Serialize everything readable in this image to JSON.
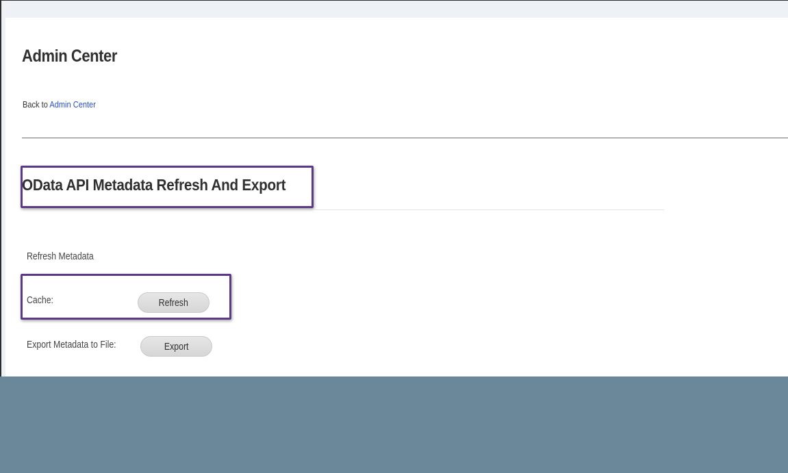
{
  "header": {
    "title": "Admin Center",
    "breadcrumb": {
      "prefix": "Back to",
      "link_label": "Admin Center"
    }
  },
  "section": {
    "title": "OData API Metadata Refresh And Export",
    "subsection_label": "Refresh Metadata",
    "cache": {
      "label": "Cache:",
      "button_label": "Refresh"
    },
    "export": {
      "label": "Export Metadata to File:",
      "button_label": "Export"
    }
  },
  "colors": {
    "page_background": "#eef2f6",
    "panel_background": "#ffffff",
    "link": "#2b4fd0",
    "highlight_border": "#5a3a87",
    "button_background": "#dddddd",
    "footer_band": "#6b879a"
  }
}
